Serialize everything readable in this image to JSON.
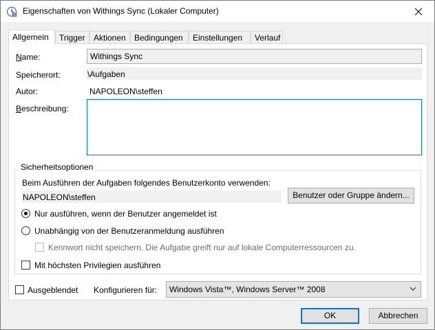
{
  "window": {
    "title": "Eigenschaften von Withings Sync (Lokaler Computer)"
  },
  "tabs": [
    {
      "label": "Allgemein",
      "active": true
    },
    {
      "label": "Trigger",
      "active": false
    },
    {
      "label": "Aktionen",
      "active": false
    },
    {
      "label": "Bedingungen",
      "active": false
    },
    {
      "label": "Einstellungen",
      "active": false
    },
    {
      "label": "Verlauf",
      "active": false
    }
  ],
  "general": {
    "name_label": "Name:",
    "name_value": "Withings Sync",
    "location_label": "Speicherort:",
    "location_value": "\\Aufgaben",
    "author_label": "Autor:",
    "author_value": "NAPOLEON\\steffen",
    "description_label": "Beschreibung:",
    "description_value": ""
  },
  "security": {
    "group_label": "Sicherheitsoptionen",
    "account_prompt": "Beim Ausführen der Aufgaben folgendes Benutzerkonto verwenden:",
    "account_value": "NAPOLEON\\steffen",
    "change_user_button": "Benutzer oder Gruppe ändern...",
    "radio_logged_on": {
      "label": "Nur ausführen, wenn der Benutzer angemeldet ist",
      "checked": true
    },
    "radio_independent": {
      "label": "Unabhängig von der Benutzeranmeldung ausführen",
      "checked": false
    },
    "no_password_check": {
      "label": "Kennwort nicht speichern. Die Aufgabe greift nur auf lokale Computerressourcen zu.",
      "checked": false,
      "enabled": false
    },
    "highest_priv_check": {
      "label": "Mit höchsten Privilegien ausführen",
      "checked": false
    }
  },
  "bottom": {
    "hidden_check": {
      "label": "Ausgeblendet",
      "checked": false
    },
    "configure_label": "Konfigurieren für:",
    "configure_value": "Windows Vista™, Windows Server™ 2008"
  },
  "buttons": {
    "ok": "OK",
    "cancel": "Abbrechen"
  },
  "colors": {
    "accent": "#0078d7",
    "window_bg": "#f0f0f0"
  }
}
